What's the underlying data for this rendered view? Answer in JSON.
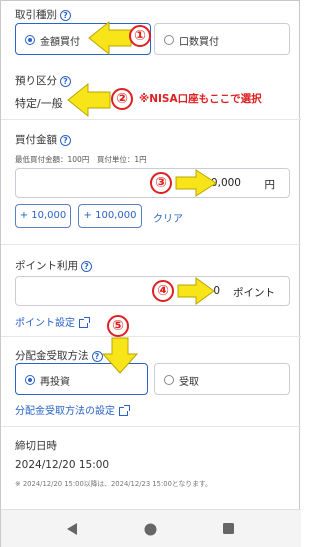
{
  "trade_type": {
    "label": "取引種別",
    "options": [
      "金額買付",
      "口数買付"
    ],
    "selected": 0
  },
  "account_type": {
    "label": "預り区分",
    "value": "特定/一般"
  },
  "amount": {
    "label": "買付金額",
    "min_info": "最低買付金額：100円　買付単位：1円",
    "value": "30,000",
    "unit": "円",
    "quick_add": [
      "+ 10,000",
      "+ 100,000"
    ],
    "clear": "クリア"
  },
  "points": {
    "label": "ポイント利用",
    "value": "0",
    "unit": "ポイント",
    "settings_link": "ポイント設定"
  },
  "dividend": {
    "label": "分配金受取方法",
    "options": [
      "再投資",
      "受取"
    ],
    "selected": 0,
    "settings_link": "分配金受取方法の設定"
  },
  "deadline": {
    "label": "締切日時",
    "value": "2024/12/20 15:00",
    "note": "※ 2024/12/20 15:00以降は、2024/12/23 15:00となります。"
  },
  "annotations": {
    "markers": [
      "①",
      "②",
      "③",
      "④",
      "⑤"
    ],
    "nisa_note": "※NISA口座もここで選択"
  },
  "nav": {
    "icons": [
      "back-icon",
      "home-icon",
      "recents-icon"
    ]
  },
  "colors": {
    "accent": "#2a63c7",
    "arrow": "#f7e51a",
    "annotation": "#e02020"
  }
}
